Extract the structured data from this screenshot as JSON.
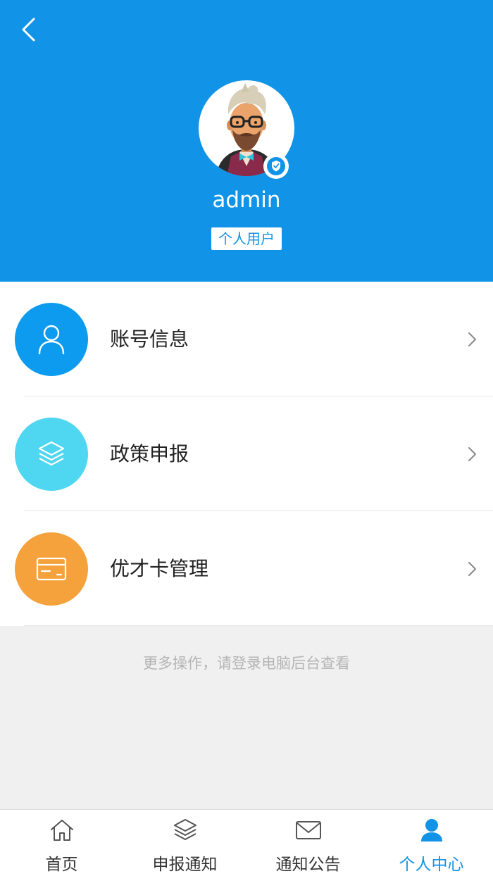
{
  "header": {
    "username": "admin",
    "user_type": "个人用户"
  },
  "icons": {
    "back": "back-arrow-icon",
    "verified": "verified-shield-icon"
  },
  "menu": {
    "items": [
      {
        "label": "账号信息",
        "icon": "user-icon",
        "color": "#0d9bf0"
      },
      {
        "label": "政策申报",
        "icon": "layers-icon",
        "color": "#4fd6f0"
      },
      {
        "label": "优才卡管理",
        "icon": "card-icon",
        "color": "#f5a23c"
      }
    ]
  },
  "footer_note": "更多操作，请登录电脑后台查看",
  "tabbar": {
    "tabs": [
      {
        "label": "首页",
        "icon": "home-icon",
        "active": false
      },
      {
        "label": "申报通知",
        "icon": "layers-icon",
        "active": false
      },
      {
        "label": "通知公告",
        "icon": "mail-icon",
        "active": false
      },
      {
        "label": "个人中心",
        "icon": "person-icon",
        "active": true
      }
    ]
  },
  "colors": {
    "primary": "#1194e8",
    "background": "#f0f0f0",
    "text": "#222222",
    "muted": "#b5b5b5"
  }
}
